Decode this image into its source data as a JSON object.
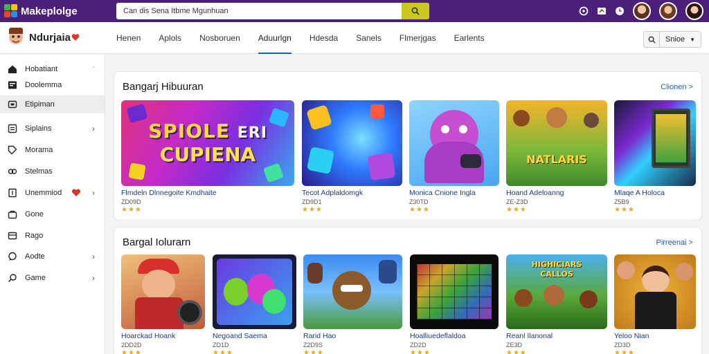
{
  "app": {
    "name": "Makeplolge",
    "search_value": "Can dis Sena Itbme Mgunhuan",
    "brand": "Ndurjaia"
  },
  "nav_tabs": [
    {
      "label": "Henen"
    },
    {
      "label": "Aplols"
    },
    {
      "label": "Nosboruen"
    },
    {
      "label": "Aduurlgn",
      "active": true
    },
    {
      "label": "Hdesda"
    },
    {
      "label": "Sanels"
    },
    {
      "label": "Flmerjgas"
    },
    {
      "label": "Earlents"
    }
  ],
  "filter_select": "Snioe",
  "sidebar": [
    {
      "label": "Hobatiant",
      "icon": "home-icon",
      "chevron": "small"
    },
    {
      "label": "Doolemma",
      "icon": "news-icon"
    },
    {
      "label": "Etipiman",
      "icon": "store-icon",
      "active": true
    },
    {
      "label": "Siplains",
      "icon": "grid-icon",
      "chevron": true
    },
    {
      "label": "Morama",
      "icon": "tag-icon"
    },
    {
      "label": "Stelmas",
      "icon": "link-icon"
    },
    {
      "label": "Unemmiod",
      "icon": "doc-icon",
      "chevron": true,
      "badge": true
    },
    {
      "label": "Gone",
      "icon": "bag-icon"
    },
    {
      "label": "Rago",
      "icon": "card-icon"
    },
    {
      "label": "Aodte",
      "icon": "chat-icon",
      "chevron": true
    },
    {
      "label": "Game",
      "icon": "search-icon",
      "chevron": true
    }
  ],
  "sections": [
    {
      "title": "Bangarj Hibuuran",
      "link": "Clionen >",
      "cards": [
        {
          "name": "Flmdeln Dlnnegoite Kmdhaite",
          "meta": "ZD09D",
          "stars": "★★★",
          "banner_l1": "SPIOLE",
          "banner_l2": "ERI",
          "banner_l3": "CUPIENA"
        },
        {
          "name": "Tecot Adplaldomgk",
          "meta": "ZD9D1",
          "stars": "★★★"
        },
        {
          "name": "Monica Cnione Ingla",
          "meta": "Z30TD",
          "stars": "★★★"
        },
        {
          "name": "Hoand Adeloanng",
          "meta": "ZE-Z3D",
          "stars": "★★★",
          "banner": "NATLARIS"
        },
        {
          "name": "Mlaqe A Holoca",
          "meta": "Z5B9",
          "stars": "★★★"
        }
      ]
    },
    {
      "title": "Bargal Iolurarn",
      "link": "Pirreenai >",
      "cards": [
        {
          "name": "Hoarckad Hoank",
          "meta": "2DD2D",
          "stars": "★★★"
        },
        {
          "name": "Negoand Saema",
          "meta": "ZD1D",
          "stars": "★★★"
        },
        {
          "name": "Rarid Hao",
          "meta": "Z2D9S",
          "stars": "★★★"
        },
        {
          "name": "Hoalliuedeflaldoa",
          "meta": "ZD2D",
          "stars": "★★★"
        },
        {
          "name": "Reanl Ilanonal",
          "meta": "ZE3D",
          "stars": "★★★",
          "banner_l1": "HIGHICIARS",
          "banner_l2": "CALLOS"
        },
        {
          "name": "Yeloo Nian",
          "meta": "ZD3D",
          "stars": "★★★"
        }
      ]
    }
  ],
  "colors": {
    "topbar": "#4b1f7a",
    "search_button": "#c8c81e",
    "link": "#1a5fb4",
    "star": "#e8a91a"
  }
}
